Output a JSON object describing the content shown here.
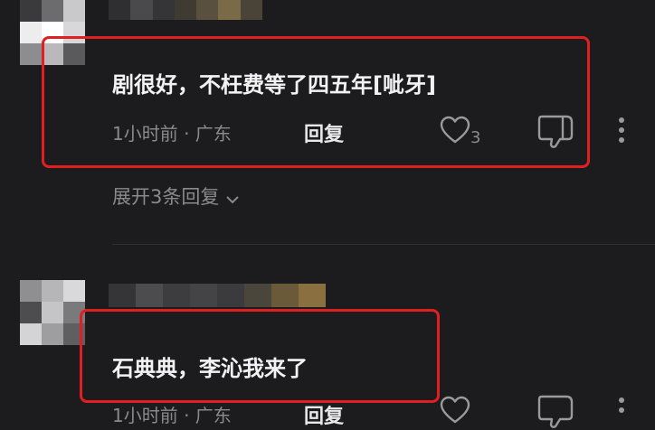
{
  "comments": [
    {
      "text": "剧很好，不枉费等了四五年[呲牙]",
      "time_location": "1小时前 · 广东",
      "reply_label": "回复",
      "like_count": "3",
      "expand_replies": "展开3条回复"
    },
    {
      "text": "石典典，李沁我来了",
      "time_location": "1小时前 · 广东",
      "reply_label": "回复"
    }
  ],
  "icons": {
    "like": "heart-icon",
    "dislike": "thumb-down-icon",
    "more": "more-vertical-icon",
    "expand": "chevron-down-icon"
  },
  "colors": {
    "background": "#1c1c1f",
    "highlight_box": "#e02020",
    "text_primary": "#f2f2f2",
    "text_secondary": "#8a8a8e"
  }
}
